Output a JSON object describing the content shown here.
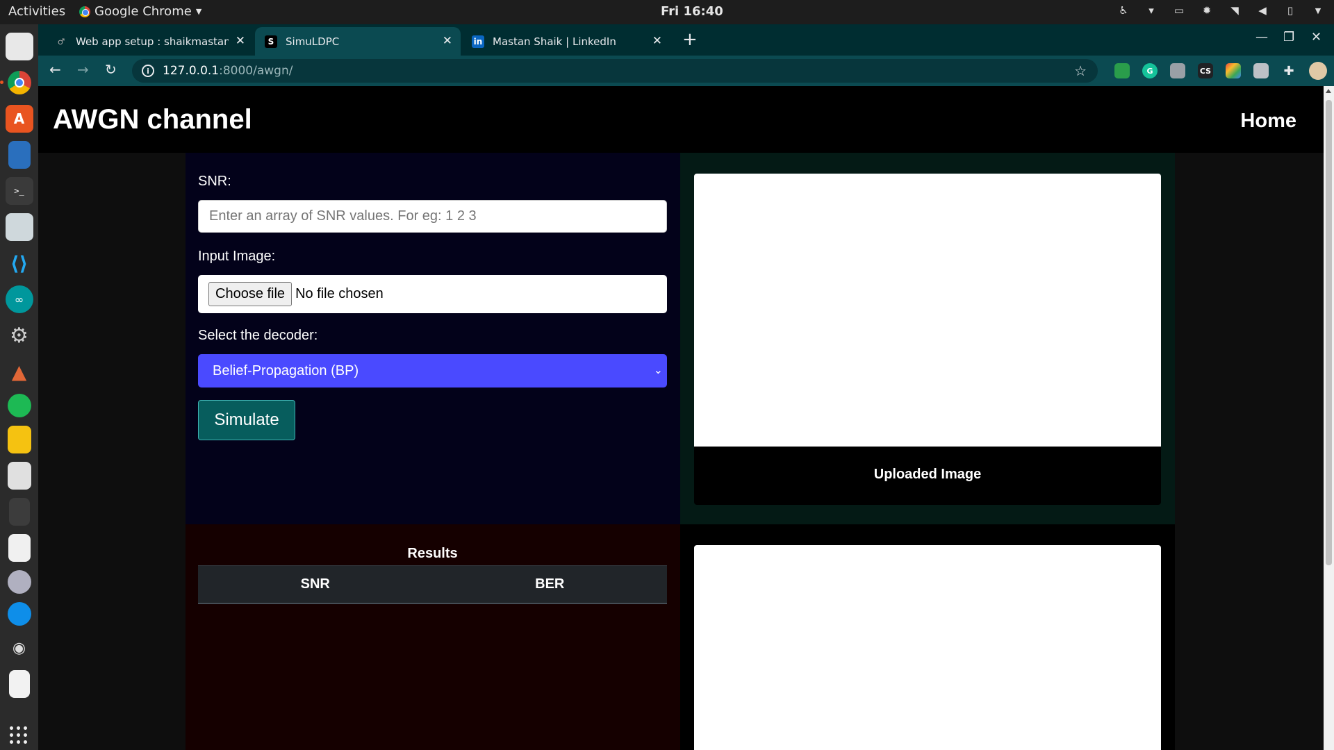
{
  "os": {
    "activities": "Activities",
    "app_name": "Google Chrome",
    "clock": "Fri 16:40"
  },
  "dock": {
    "items": [
      "files",
      "chrome",
      "software-center",
      "writer",
      "terminal",
      "keyboard-app",
      "vscode",
      "arduino",
      "settings",
      "matlab",
      "spotify",
      "notes",
      "sheets",
      "calculator",
      "drawing",
      "screenshot",
      "teamviewer",
      "eye",
      "text-editor"
    ]
  },
  "browser": {
    "tabs": [
      {
        "title": "Web app setup : shaikmastan : P",
        "icon": "pythonanywhere-icon"
      },
      {
        "title": "SimuLDPC",
        "icon": "s-favicon"
      },
      {
        "title": "Mastan Shaik | LinkedIn",
        "icon": "linkedin-icon"
      }
    ],
    "url_host": "127.0.0.1",
    "url_path": ":8000/awgn/",
    "extensions": [
      {
        "name": "mail-ext-icon",
        "label": "",
        "color": "#2a9d4b"
      },
      {
        "name": "grammarly-icon",
        "label": "G",
        "color": "#15c39a"
      },
      {
        "name": "location-ext-icon",
        "label": "",
        "color": "#9aa0a6"
      },
      {
        "name": "cs-ext-icon",
        "label": "CS",
        "color": "#202124"
      },
      {
        "name": "colorful-ext-icon",
        "label": "",
        "color": "#e8453c"
      },
      {
        "name": "gray-ext-icon",
        "label": "",
        "color": "#bdc1c6"
      },
      {
        "name": "puzzle-icon",
        "label": "",
        "color": "#0b4a51"
      }
    ]
  },
  "page": {
    "brand": "AWGN channel",
    "nav_home": "Home",
    "form": {
      "snr_label": "SNR:",
      "snr_placeholder": "Enter an array of SNR values. For eg: 1 2 3",
      "image_label": "Input Image:",
      "file_button": "Choose file",
      "file_status": "No file chosen",
      "decoder_label": "Select the decoder:",
      "decoder_selected": "Belief-Propagation (BP)",
      "simulate_button": "Simulate"
    },
    "uploaded_caption": "Uploaded Image",
    "results": {
      "title": "Results",
      "columns": [
        "SNR",
        "BER"
      ]
    }
  }
}
